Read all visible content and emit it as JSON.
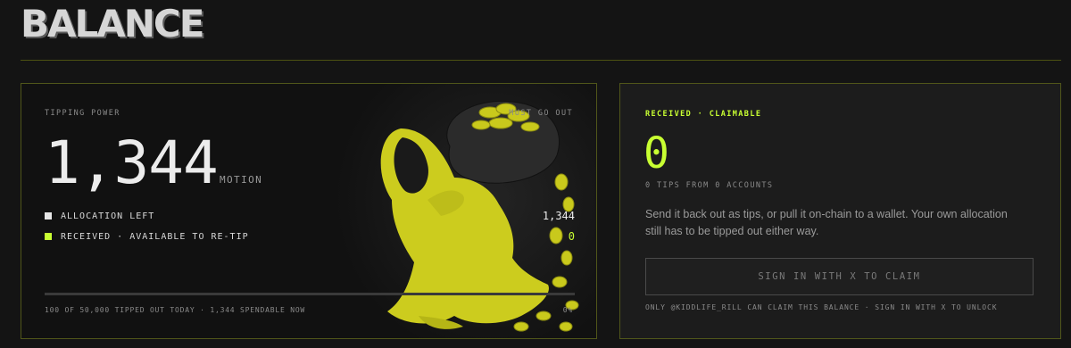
{
  "page": {
    "title": "BALANCE"
  },
  "tipping": {
    "label": "TIPPING POWER",
    "must_go_out": "MUST GO OUT",
    "amount": "1,344",
    "unit": "MOTION",
    "rows": [
      {
        "label": "ALLOCATION LEFT",
        "value": "1,344",
        "color": "#e6e6e6"
      },
      {
        "label": "RECEIVED · AVAILABLE TO RE-TIP",
        "value": "0",
        "color": "#c8ff32"
      }
    ],
    "progress_fraction": 0.0,
    "footer_left": "100 OF 50,000 TIPPED OUT TODAY · 1,344 SPENDABLE NOW",
    "footer_right": "0%"
  },
  "claim": {
    "label": "RECEIVED · CLAIMABLE",
    "amount": "0",
    "sub": "0 TIPS FROM 0 ACCOUNTS",
    "description": "Send it back out as tips, or pull it on-chain to a wallet. Your own allocation still has to be tipped out either way.",
    "button_label": "SIGN IN WITH X TO CLAIM",
    "note": "ONLY @KIDDLIFE_RILL CAN CLAIM THIS BALANCE · SIGN IN WITH X TO UNLOCK"
  },
  "colors": {
    "accent": "#c8ff32",
    "mascot": "#d2d21e",
    "bag": "#2a2a2a"
  },
  "icons": {
    "mascot": "hooded-figure-with-coin-bag-illustration"
  }
}
